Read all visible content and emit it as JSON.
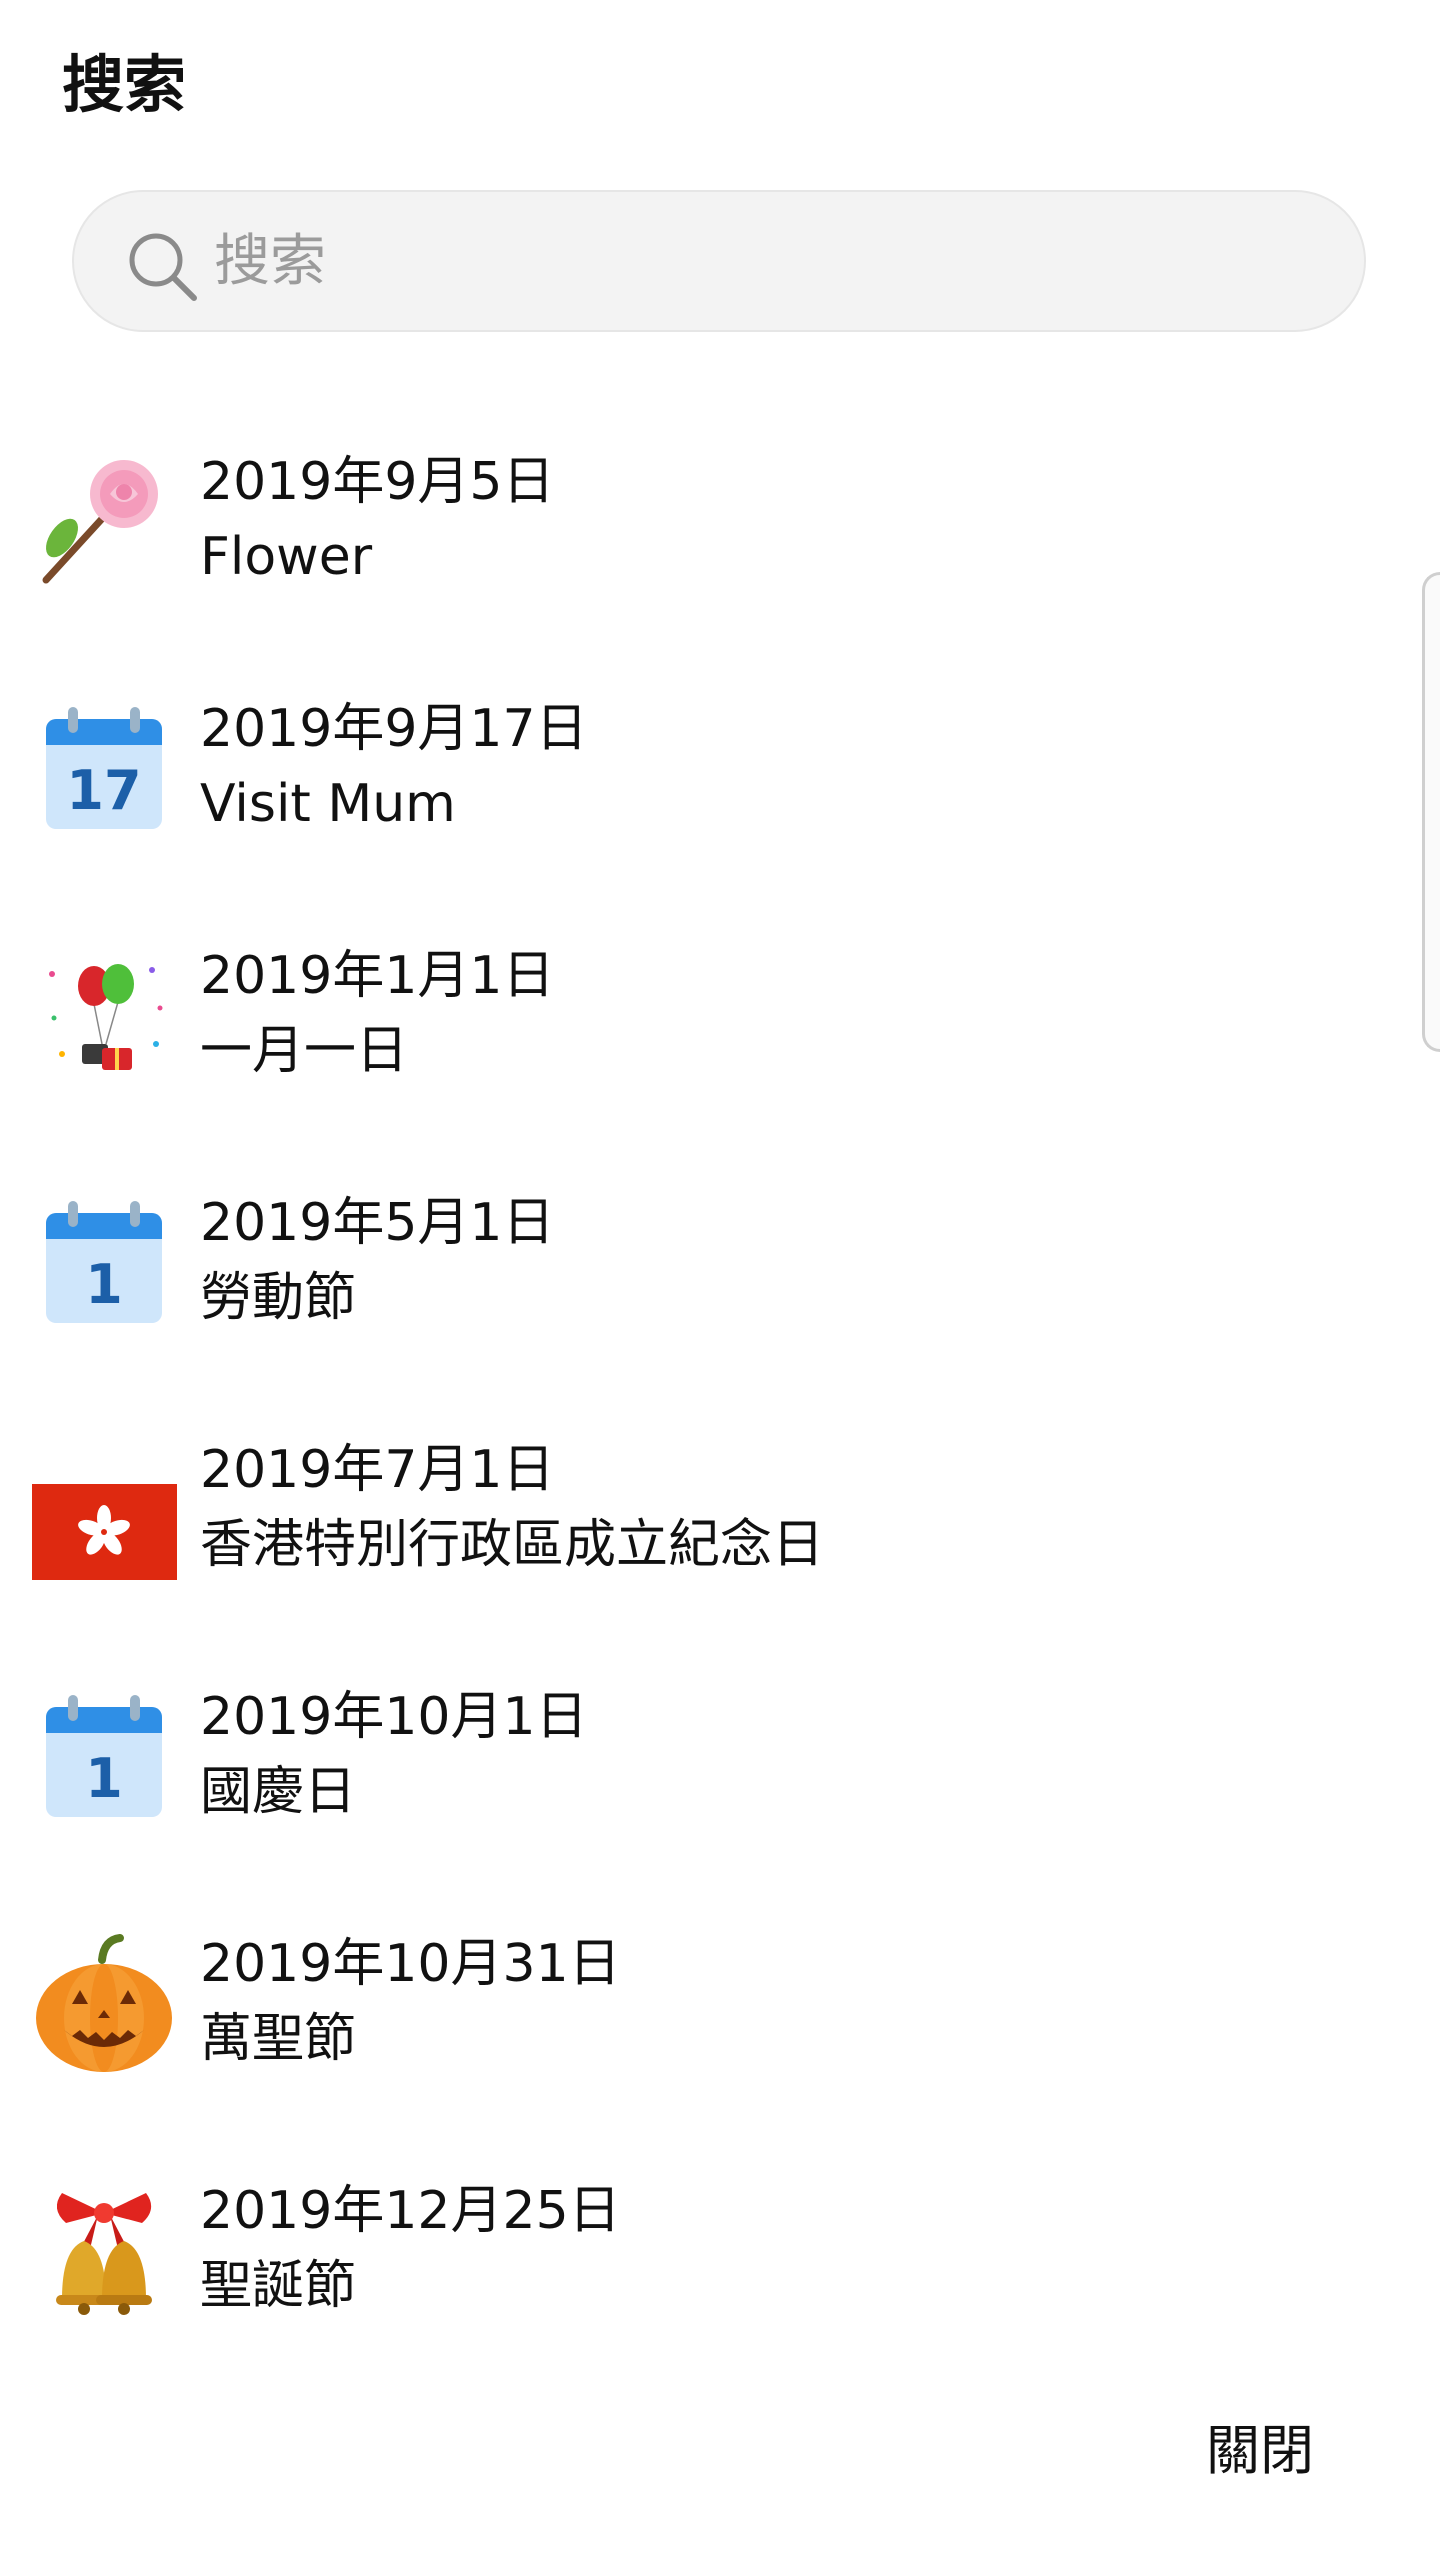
{
  "header": {
    "title": "搜索"
  },
  "search": {
    "placeholder": "搜索",
    "value": ""
  },
  "results": [
    {
      "date": "2019年9月5日",
      "name": "Flower",
      "icon": "rose-icon"
    },
    {
      "date": "2019年9月17日",
      "name": "Visit Mum",
      "icon": "calendar-icon",
      "icon_day": "17"
    },
    {
      "date": "2019年1月1日",
      "name": "一月一日",
      "icon": "balloons-celebration-icon"
    },
    {
      "date": "2019年5月1日",
      "name": "勞動節",
      "icon": "calendar-icon",
      "icon_day": "1"
    },
    {
      "date": "2019年7月1日",
      "name": "香港特別行政區成立紀念日",
      "icon": "hong-kong-flag-icon"
    },
    {
      "date": "2019年10月1日",
      "name": "國慶日",
      "icon": "calendar-icon",
      "icon_day": "1"
    },
    {
      "date": "2019年10月31日",
      "name": "萬聖節",
      "icon": "pumpkin-icon"
    },
    {
      "date": "2019年12月25日",
      "name": "聖誕節",
      "icon": "christmas-bells-icon"
    }
  ],
  "footer": {
    "close_label": "關閉"
  },
  "colors": {
    "calendar_blue": "#2f8fe6",
    "calendar_light": "#cfe6fb",
    "calendar_text": "#1c5fa8",
    "flag_red": "#de2910",
    "pumpkin_orange": "#f28c1f",
    "placeholder_gray": "#9b9b9b",
    "search_bg": "#f3f3f3"
  }
}
